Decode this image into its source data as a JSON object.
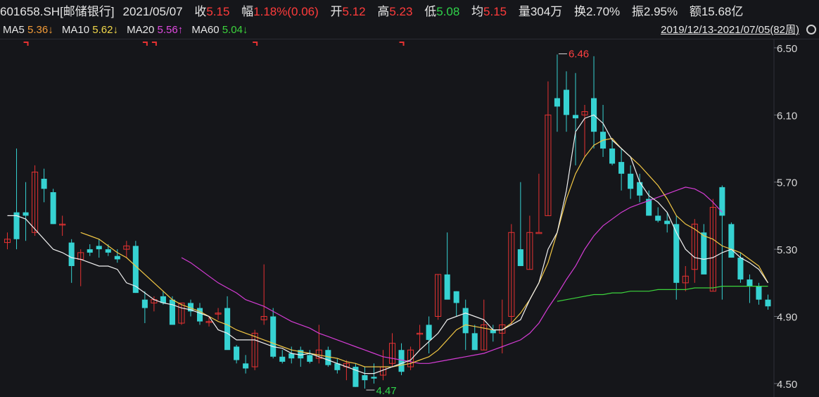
{
  "header": {
    "code": "601658.SH[邮储银行]",
    "date": "2021/05/07",
    "close_label": "收",
    "close": "5.15",
    "change_label": "幅",
    "change_pct": "1.18%",
    "change_abs": "(0.06)",
    "open_label": "开",
    "open": "5.12",
    "high_label": "高",
    "high": "5.23",
    "low_label": "低",
    "low": "5.08",
    "avg_label": "均",
    "avg": "5.15",
    "volume_label": "量",
    "volume": "304万",
    "turnover_label": "换",
    "turnover": "2.70%",
    "amplitude_label": "振",
    "amplitude": "2.95%",
    "amount_label": "额",
    "amount": "15.68亿"
  },
  "ma_bar": {
    "ma5_label": "MA5",
    "ma5": "5.36↓",
    "ma10_label": "MA10",
    "ma10": "5.62↓",
    "ma20_label": "MA20",
    "ma20": "5.56↑",
    "ma60_label": "MA60",
    "ma60": "5.04↓",
    "range": "2019/12/13-2021/07/05(82周)"
  },
  "colors": {
    "bg": "#15161a",
    "up": "#e63232",
    "down": "#36d2d2",
    "ma5": "#f0f0f0",
    "ma10": "#f2c744",
    "ma20": "#d43cd4",
    "ma60": "#3cd43c",
    "grid": "#2e3038",
    "axis_text": "#d7d7d7",
    "high_marker": "#ff4040",
    "low_marker": "#2fd44a"
  },
  "chart_data": {
    "type": "candlestick",
    "title": "",
    "ylim": [
      4.42,
      6.55
    ],
    "yticks": [
      "6.50",
      "6.10",
      "5.70",
      "5.30",
      "4.90",
      "4.50"
    ],
    "annotations": {
      "high_label": "6.46",
      "low_label": "4.47"
    },
    "candles": [
      [
        5.34,
        5.4,
        5.3,
        5.36
      ],
      [
        5.52,
        5.9,
        5.3,
        5.36
      ],
      [
        5.52,
        5.7,
        5.35,
        5.5
      ],
      [
        5.4,
        5.8,
        5.38,
        5.76
      ],
      [
        5.72,
        5.78,
        5.58,
        5.66
      ],
      [
        5.64,
        5.66,
        5.45,
        5.45
      ],
      [
        5.45,
        5.5,
        5.38,
        5.45
      ],
      [
        5.34,
        5.36,
        5.1,
        5.2
      ],
      [
        5.24,
        5.3,
        5.08,
        5.28
      ],
      [
        5.3,
        5.33,
        5.26,
        5.28
      ],
      [
        5.32,
        5.36,
        5.25,
        5.3
      ],
      [
        5.3,
        5.33,
        5.26,
        5.28
      ],
      [
        5.26,
        5.3,
        5.22,
        5.24
      ],
      [
        5.3,
        5.35,
        5.25,
        5.32
      ],
      [
        5.32,
        5.35,
        5.04,
        5.04
      ],
      [
        5.0,
        5.05,
        4.86,
        4.95
      ],
      [
        4.98,
        5.02,
        4.93,
        5.0
      ],
      [
        5.02,
        5.05,
        4.97,
        4.98
      ],
      [
        5.0,
        5.02,
        4.85,
        4.85
      ],
      [
        4.86,
        4.98,
        4.85,
        4.98
      ],
      [
        4.98,
        5.0,
        4.9,
        4.93
      ],
      [
        4.95,
        4.98,
        4.85,
        4.87
      ],
      [
        4.87,
        4.9,
        4.84,
        4.87
      ],
      [
        4.92,
        4.95,
        4.88,
        4.92
      ],
      [
        4.95,
        5.02,
        4.75,
        4.7
      ],
      [
        4.72,
        4.73,
        4.62,
        4.64
      ],
      [
        4.62,
        4.67,
        4.56,
        4.59
      ],
      [
        4.6,
        4.82,
        4.58,
        4.8
      ],
      [
        4.88,
        5.21,
        4.85,
        4.9
      ],
      [
        4.9,
        4.95,
        4.65,
        4.66
      ],
      [
        4.66,
        4.7,
        4.62,
        4.63
      ],
      [
        4.68,
        4.72,
        4.62,
        4.65
      ],
      [
        4.7,
        4.72,
        4.6,
        4.65
      ],
      [
        4.67,
        4.7,
        4.62,
        4.63
      ],
      [
        4.65,
        4.85,
        4.62,
        4.7
      ],
      [
        4.7,
        4.72,
        4.6,
        4.61
      ],
      [
        4.62,
        4.65,
        4.56,
        4.58
      ],
      [
        4.6,
        4.64,
        4.52,
        4.62
      ],
      [
        4.6,
        4.62,
        4.48,
        4.48
      ],
      [
        4.55,
        4.6,
        4.47,
        4.52
      ],
      [
        4.54,
        4.62,
        4.5,
        4.53
      ],
      [
        4.55,
        4.7,
        4.52,
        4.6
      ],
      [
        4.62,
        4.8,
        4.6,
        4.74
      ],
      [
        4.7,
        4.74,
        4.55,
        4.57
      ],
      [
        4.6,
        4.72,
        4.58,
        4.7
      ],
      [
        4.8,
        4.85,
        4.7,
        4.8
      ],
      [
        4.85,
        4.9,
        4.68,
        4.76
      ],
      [
        4.9,
        5.15,
        4.88,
        5.15
      ],
      [
        5.15,
        5.4,
        5.1,
        5.0
      ],
      [
        5.05,
        5.05,
        4.9,
        4.98
      ],
      [
        4.95,
        5.0,
        4.7,
        4.8
      ],
      [
        4.8,
        4.85,
        4.7,
        4.7
      ],
      [
        4.7,
        5.0,
        4.7,
        4.85
      ],
      [
        4.82,
        4.85,
        4.75,
        4.8
      ],
      [
        4.8,
        5.0,
        4.68,
        4.85
      ],
      [
        4.9,
        5.45,
        4.85,
        5.4
      ],
      [
        5.3,
        5.7,
        5.2,
        5.2
      ],
      [
        5.18,
        5.5,
        5.18,
        5.4
      ],
      [
        5.4,
        5.75,
        5.4,
        5.4
      ],
      [
        5.5,
        6.3,
        5.5,
        6.1
      ],
      [
        6.2,
        6.46,
        6.0,
        6.15
      ],
      [
        6.25,
        6.36,
        6.0,
        6.1
      ],
      [
        6.1,
        6.35,
        5.8,
        6.08
      ],
      [
        6.1,
        6.16,
        5.85,
        6.12
      ],
      [
        6.2,
        6.45,
        5.9,
        6.0
      ],
      [
        6.0,
        6.16,
        5.85,
        5.9
      ],
      [
        5.9,
        5.95,
        5.8,
        5.81
      ],
      [
        5.82,
        5.9,
        5.65,
        5.75
      ],
      [
        5.75,
        5.8,
        5.6,
        5.66
      ],
      [
        5.7,
        5.75,
        5.58,
        5.62
      ],
      [
        5.6,
        5.65,
        5.5,
        5.5
      ],
      [
        5.5,
        5.55,
        5.46,
        5.47
      ],
      [
        5.47,
        5.52,
        5.4,
        5.45
      ],
      [
        5.45,
        5.5,
        5.0,
        5.1
      ],
      [
        5.1,
        5.2,
        5.05,
        5.14
      ],
      [
        5.18,
        5.48,
        5.1,
        5.45
      ],
      [
        5.4,
        5.45,
        5.18,
        5.15
      ],
      [
        5.05,
        5.6,
        5.05,
        5.55
      ],
      [
        5.67,
        5.68,
        5.0,
        5.5
      ],
      [
        5.45,
        5.46,
        5.25,
        5.25
      ],
      [
        5.25,
        5.28,
        5.1,
        5.12
      ],
      [
        5.12,
        5.15,
        4.98,
        5.08
      ],
      [
        5.08,
        5.1,
        4.97,
        5.0
      ],
      [
        5.0,
        5.03,
        4.94,
        4.96
      ]
    ],
    "ma5": [
      5.5,
      5.5,
      5.48,
      5.42,
      5.36,
      5.3,
      5.28,
      5.25,
      5.24,
      5.22,
      5.2,
      5.2,
      5.18,
      5.1,
      5.08,
      5.04,
      5.0,
      4.98,
      4.97,
      4.95,
      4.94,
      4.92,
      4.9,
      4.82,
      4.8,
      4.76,
      4.76,
      4.76,
      4.74,
      4.72,
      4.71,
      4.68,
      4.67,
      4.68,
      4.66,
      4.64,
      4.62,
      4.6,
      4.58,
      4.56,
      4.56,
      4.58,
      4.6,
      4.62,
      4.64,
      4.7,
      4.75,
      4.8,
      4.88,
      4.9,
      4.92,
      4.9,
      4.88,
      4.82,
      4.82,
      4.85,
      4.88,
      5.0,
      5.1,
      5.3,
      5.4,
      5.65,
      6.0,
      6.08,
      6.1,
      6.05,
      5.95,
      5.9,
      5.85,
      5.7,
      5.62,
      5.58,
      5.52,
      5.4,
      5.3,
      5.25,
      5.24,
      5.25,
      5.28,
      5.3,
      5.25,
      5.22,
      5.18,
      5.1
    ],
    "ma10": [
      null,
      null,
      null,
      null,
      null,
      null,
      null,
      null,
      5.4,
      5.38,
      5.36,
      5.32,
      5.28,
      5.25,
      5.2,
      5.15,
      5.1,
      5.05,
      5.0,
      4.97,
      4.95,
      4.93,
      4.9,
      4.87,
      4.85,
      4.82,
      4.8,
      4.78,
      4.76,
      4.74,
      4.72,
      4.7,
      4.69,
      4.68,
      4.67,
      4.66,
      4.65,
      4.63,
      4.62,
      4.6,
      4.6,
      4.6,
      4.6,
      4.61,
      4.62,
      4.64,
      4.66,
      4.7,
      4.76,
      4.82,
      4.85,
      4.84,
      4.83,
      4.82,
      4.82,
      4.86,
      4.92,
      5.0,
      5.1,
      5.22,
      5.4,
      5.6,
      5.75,
      5.85,
      5.92,
      5.95,
      5.96,
      5.9,
      5.85,
      5.8,
      5.74,
      5.68,
      5.6,
      5.5,
      5.45,
      5.42,
      5.38,
      5.36,
      5.32,
      5.3,
      5.28,
      5.24,
      5.2,
      5.1
    ],
    "ma20": [
      null,
      null,
      null,
      null,
      null,
      null,
      null,
      null,
      null,
      null,
      null,
      null,
      null,
      null,
      null,
      null,
      null,
      null,
      null,
      5.25,
      5.22,
      5.18,
      5.14,
      5.1,
      5.07,
      5.04,
      5.0,
      4.98,
      4.96,
      4.93,
      4.9,
      4.87,
      4.85,
      4.83,
      4.8,
      4.78,
      4.76,
      4.74,
      4.72,
      4.7,
      4.68,
      4.66,
      4.65,
      4.64,
      4.63,
      4.62,
      4.62,
      4.63,
      4.64,
      4.65,
      4.66,
      4.67,
      4.68,
      4.7,
      4.72,
      4.74,
      4.76,
      4.8,
      4.86,
      4.95,
      5.03,
      5.12,
      5.2,
      5.3,
      5.38,
      5.44,
      5.48,
      5.52,
      5.55,
      5.57,
      5.59,
      5.61,
      5.63,
      5.65,
      5.67,
      5.66,
      5.63,
      5.58,
      5.52
    ],
    "ma60": [
      null,
      null,
      null,
      null,
      null,
      null,
      null,
      null,
      null,
      null,
      null,
      null,
      null,
      null,
      null,
      null,
      null,
      null,
      null,
      null,
      null,
      null,
      null,
      null,
      null,
      null,
      null,
      null,
      null,
      null,
      null,
      null,
      null,
      null,
      null,
      null,
      null,
      null,
      null,
      null,
      null,
      null,
      null,
      null,
      null,
      null,
      null,
      null,
      null,
      null,
      null,
      null,
      null,
      null,
      null,
      null,
      null,
      null,
      null,
      null,
      4.99,
      5.0,
      5.01,
      5.02,
      5.03,
      5.03,
      5.04,
      5.04,
      5.05,
      5.05,
      5.05,
      5.06,
      5.06,
      5.06,
      5.06,
      5.07,
      5.07,
      5.07,
      5.08,
      5.08,
      5.08,
      5.08,
      5.08,
      5.08
    ],
    "top_markers": [
      2,
      15,
      16,
      27,
      43
    ]
  }
}
